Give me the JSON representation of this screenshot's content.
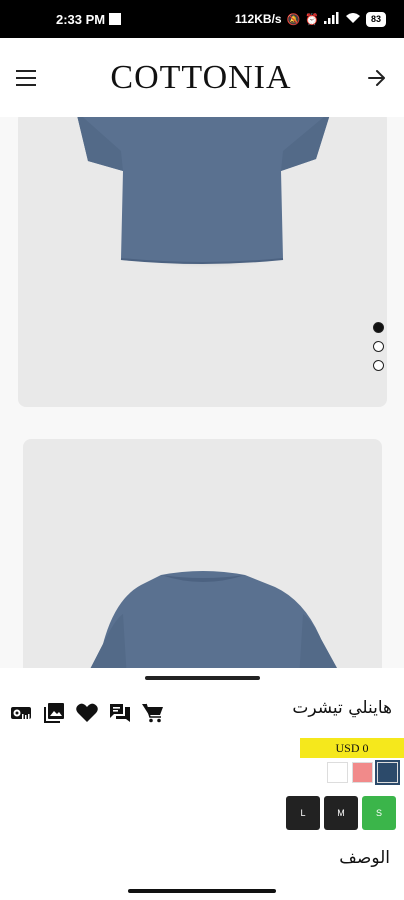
{
  "status_bar": {
    "time": "2:33 PM",
    "network_speed": "112KB/s",
    "battery": "83"
  },
  "header": {
    "brand": "COTTONIA",
    "menu_icon": "hamburger-menu-icon",
    "forward_icon": "arrow-right-icon"
  },
  "gallery": {
    "images": [
      "shirt-front-view",
      "shirt-back-view"
    ],
    "product_color": "#5a7190",
    "dots": {
      "total": 3,
      "active_index": 0
    }
  },
  "product": {
    "title": "هاينلي تيشرت",
    "price": "USD 0",
    "price_badge_color": "#f5e81c",
    "colors": [
      {
        "name": "white",
        "hex": "#ffffff"
      },
      {
        "name": "pink",
        "hex": "#f18a8a"
      },
      {
        "name": "blue",
        "hex": "#2c4a6a"
      }
    ],
    "sizes": [
      "L",
      "M",
      "S"
    ],
    "selected_size": "S",
    "description_label": "الوصف"
  },
  "actions": [
    "size-chart-icon",
    "gallery-icon",
    "heart-icon",
    "chat-icon",
    "cart-icon"
  ]
}
